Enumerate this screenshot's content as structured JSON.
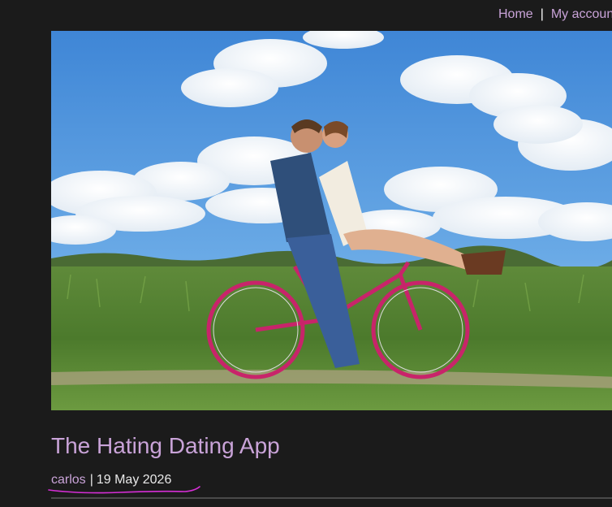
{
  "nav": {
    "home_label": "Home",
    "separator": "|",
    "account_label": "My account"
  },
  "post": {
    "title": "The Hating Dating App",
    "author": "carlos",
    "meta_separator": "|",
    "date": "19 May 2026",
    "image_alt": "Couple kissing while riding a pink bicycle in a grassy field under a cloudy blue sky"
  },
  "colors": {
    "background": "#1b1b1b",
    "link": "#c9a3d8",
    "text": "#e8e8e8",
    "annotation": "#d62ed6"
  }
}
